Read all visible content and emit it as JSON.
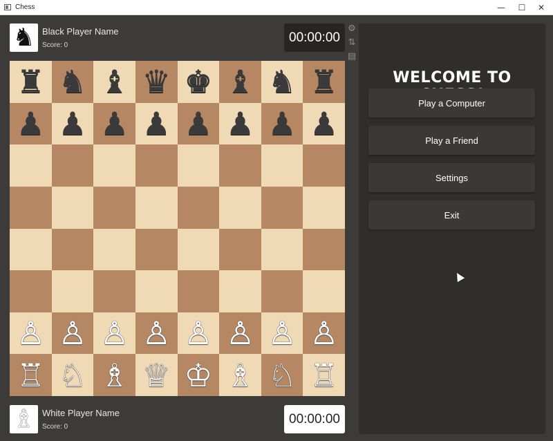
{
  "window": {
    "title": "Chess",
    "min_glyph": "—",
    "max_glyph": "☐",
    "close_glyph": "✕"
  },
  "players": {
    "black": {
      "name": "Black Player Name",
      "score": "Score: 0",
      "clock": "00:00:00",
      "avatar_glyph": "♞"
    },
    "white": {
      "name": "White Player Name",
      "score": "Score: 0",
      "clock": "00:00:00",
      "avatar_glyph": "♗"
    }
  },
  "tools": [
    {
      "name": "settings-gear-icon",
      "glyph": "⚙"
    },
    {
      "name": "flip-board-icon",
      "glyph": "⇅"
    },
    {
      "name": "save-icon",
      "glyph": "▤"
    }
  ],
  "board": {
    "light_color": "#f0d9b5",
    "dark_color": "#b58863",
    "ranks": [
      [
        "♜",
        "♞",
        "♝",
        "♛",
        "♚",
        "♝",
        "♞",
        "♜"
      ],
      [
        "♟",
        "♟",
        "♟",
        "♟",
        "♟",
        "♟",
        "♟",
        "♟"
      ],
      [
        "",
        "",
        "",
        "",
        "",
        "",
        "",
        ""
      ],
      [
        "",
        "",
        "",
        "",
        "",
        "",
        "",
        ""
      ],
      [
        "",
        "",
        "",
        "",
        "",
        "",
        "",
        ""
      ],
      [
        "",
        "",
        "",
        "",
        "",
        "",
        "",
        ""
      ],
      [
        "♙",
        "♙",
        "♙",
        "♙",
        "♙",
        "♙",
        "♙",
        "♙"
      ],
      [
        "♖",
        "♘",
        "♗",
        "♕",
        "♔",
        "♗",
        "♘",
        "♖"
      ]
    ]
  },
  "panel": {
    "welcome": "WELCOME TO CHESS!",
    "buttons": [
      {
        "id": "play-computer",
        "label": "Play a Computer"
      },
      {
        "id": "play-friend",
        "label": "Play a Friend"
      },
      {
        "id": "settings",
        "label": "Settings"
      },
      {
        "id": "exit",
        "label": "Exit"
      }
    ]
  }
}
